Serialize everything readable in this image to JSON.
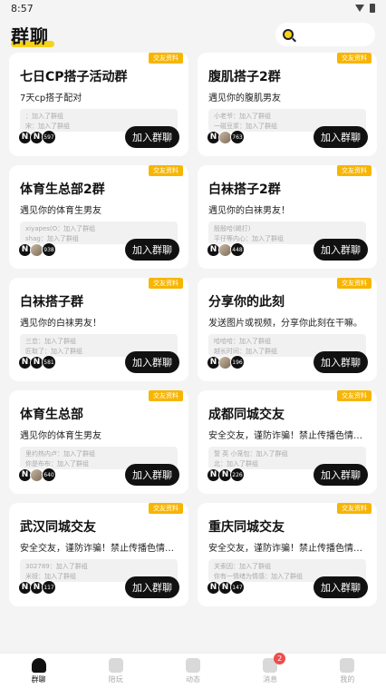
{
  "status_bar": {
    "time": "8:57"
  },
  "header": {
    "title": "群聊"
  },
  "groups": [
    {
      "badge": "交友资料",
      "title": "七日CP搭子活动群",
      "desc": "7天cp搭子配对",
      "messages": [
        "：加入了群组",
        "宋：加入了群组"
      ],
      "avatars": [
        "N",
        "N"
      ],
      "count": "597",
      "join_label": "加入群聊"
    },
    {
      "badge": "交友资料",
      "title": "腹肌搭子2群",
      "desc": "遇见你的腹肌男友",
      "messages": [
        "小老爷：加入了群组",
        "一碰豆浆：加入了群组"
      ],
      "avatars": [
        "N",
        "photo"
      ],
      "count": "763",
      "join_label": "加入群聊"
    },
    {
      "badge": "交友资料",
      "title": "体育生总部2群",
      "desc": "遇见你的体育生男友",
      "messages": [
        "xiyapes(O：加入了群组",
        "shag：加入了群组"
      ],
      "avatars": [
        "N",
        "photo"
      ],
      "count": "938",
      "join_label": "加入群聊"
    },
    {
      "badge": "交友资料",
      "title": "白袜搭子2群",
      "desc": "遇见你的白袜男友！",
      "messages": [
        "殷殷哈(踢打)",
        "平仔等内心：加入了群组"
      ],
      "avatars": [
        "N",
        "photo"
      ],
      "count": "448",
      "join_label": "加入群聊"
    },
    {
      "badge": "交友资料",
      "title": "白袜搭子群",
      "desc": "遇见你的白袜男友！",
      "messages": [
        "三恋：加入了群组",
        "匠取了：加入了群组"
      ],
      "avatars": [
        "N",
        "N"
      ],
      "count": "581",
      "join_label": "加入群聊"
    },
    {
      "badge": "交友资料",
      "title": "分享你的此刻",
      "desc": "发送图片或视频，分享你此刻在干嘛。",
      "messages": [
        "哈哈哈：加入了群组",
        "越长时间：加入了群组"
      ],
      "avatars": [
        "N",
        "photo"
      ],
      "count": "196",
      "join_label": "加入群聊"
    },
    {
      "badge": "交友资料",
      "title": "体育生总部",
      "desc": "遇见你的体育生男友",
      "messages": [
        "里约热内卢：加入了群组",
        "你是布布：加入了群组"
      ],
      "avatars": [
        "N",
        "photo"
      ],
      "count": "640",
      "join_label": "加入群聊"
    },
    {
      "badge": "交友资料",
      "title": "成都同城交友",
      "desc": "安全交友，谨防诈骗！禁止传播色情图片等...",
      "messages": [
        "誓 英 小笼包：加入了群组",
        "北：加入了群组"
      ],
      "avatars": [
        "N",
        "N"
      ],
      "count": "226",
      "join_label": "加入群聊"
    },
    {
      "badge": "交友资料",
      "title": "武汉同城交友",
      "desc": "安全交友，谨防诈骗！禁止传播色情图片...",
      "messages": [
        "302789：加入了群组",
        "米娅：加入了群组"
      ],
      "avatars": [
        "N",
        "N"
      ],
      "count": "117",
      "join_label": "加入群聊"
    },
    {
      "badge": "交友资料",
      "title": "重庆同城交友",
      "desc": "安全交友，谨防诈骗！禁止传播色情图片...",
      "messages": [
        "关索因：加入了群组",
        "你有一情绪为情感：加入了群组"
      ],
      "avatars": [
        "N",
        "N"
      ],
      "count": "147",
      "join_label": "加入群聊"
    }
  ],
  "tabs": [
    {
      "label": "群聊",
      "icon": "group-icon",
      "active": true
    },
    {
      "label": "陪玩",
      "icon": "play-icon",
      "active": false
    },
    {
      "label": "动态",
      "icon": "moments-icon",
      "active": false
    },
    {
      "label": "消息",
      "icon": "message-icon",
      "active": false,
      "badge": "2"
    },
    {
      "label": "我的",
      "icon": "profile-icon",
      "active": false
    }
  ],
  "colors": {
    "accent": "#f7d21b",
    "badge": "#f7b500",
    "button": "#111111",
    "notify": "#ee4d4d"
  }
}
